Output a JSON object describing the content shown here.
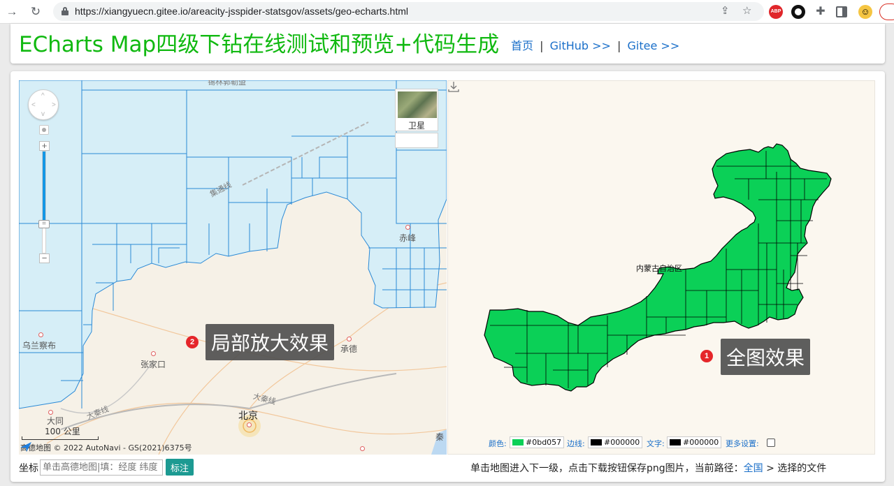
{
  "browser": {
    "url": "https://xiangyuecn.gitee.io/areacity-jsspider-statsgov/assets/geo-echarts.html",
    "abp_label": "ABP"
  },
  "header": {
    "title": "ECharts Map四级下钻在线测试和预览+代码生成",
    "links": {
      "home": "首页",
      "sep1": "|",
      "github": "GitHub >>",
      "sep2": "|",
      "gitee": "Gitee >>"
    }
  },
  "left_map": {
    "satellite_label": "卫星",
    "cities": {
      "chifeng": "赤峰",
      "wulanchabu": "乌兰察布",
      "zhangjiakou": "张家口",
      "chengde": "承德",
      "datong": "大同",
      "beijing": "北京",
      "qin": "秦"
    },
    "roads": {
      "jitong": "集通线",
      "daqin1": "大秦线",
      "daqin2": "大秦线",
      "top": "锡林郭勒盟"
    },
    "scale": "100 公里",
    "copyright": "高德地图 © 2022 AutoNavi - GS(2021)6375号",
    "callout": {
      "badge": "2",
      "text": "局部放大效果"
    }
  },
  "right_map": {
    "region_label": "内蒙古自治区",
    "callout": {
      "badge": "1",
      "text": "全图效果"
    },
    "toolbar": {
      "color_label": "颜色:",
      "color_value": "#0bd057",
      "border_label": "边线:",
      "border_value": "#000000",
      "text_label": "文字:",
      "text_value": "#000000",
      "more_label": "更多设置:"
    },
    "fill_color": "#0bd057"
  },
  "bottom": {
    "coord_label": "坐标",
    "coord_placeholder": "单击高德地图|填：经度 纬度",
    "mark_button": "标注",
    "status_text": "单击地图进入下一级，点击下载按钮保存png图片，当前路径：",
    "path_link": "全国",
    "path_rest": "> 选择的文件"
  }
}
